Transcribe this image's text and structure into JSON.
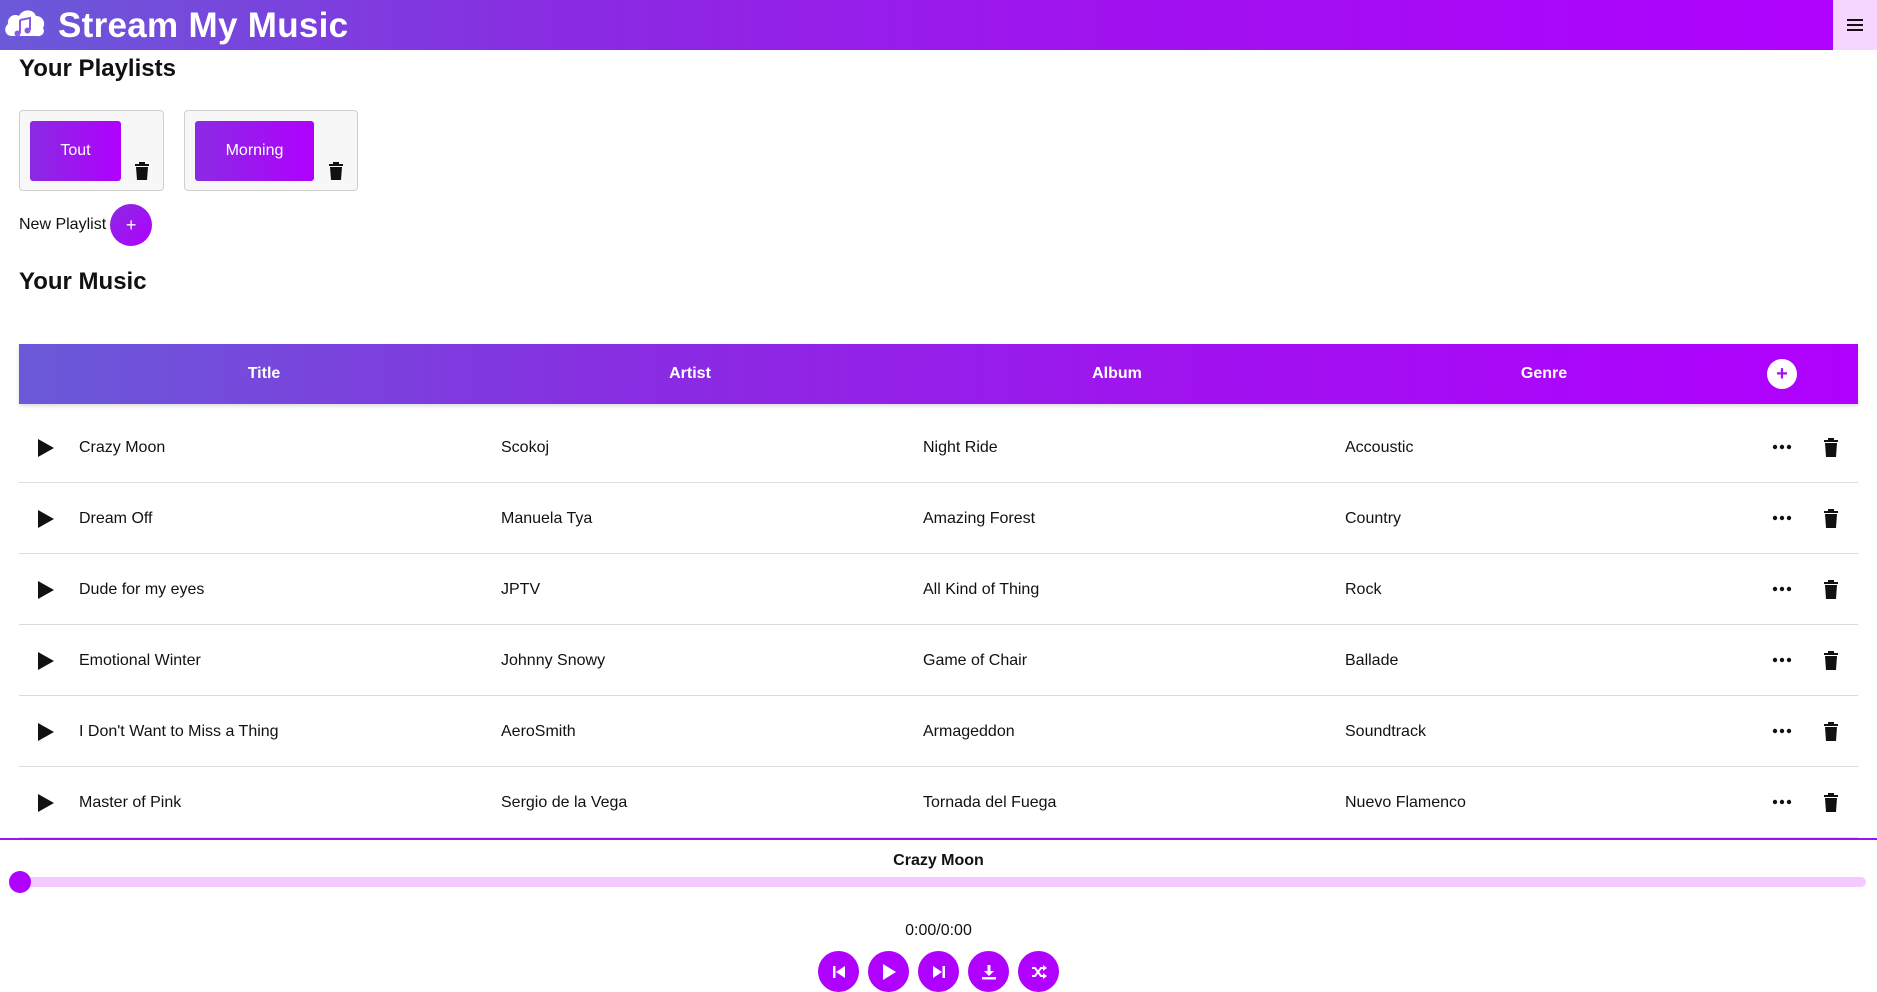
{
  "app": {
    "title": "Stream My Music",
    "accent": "#b000ff",
    "accent_light": "#f3c9ff"
  },
  "icons": {
    "logo": "cloud-music-icon",
    "menu": "hamburger-icon",
    "delete": "trash-icon",
    "more": "ellipsis-icon",
    "play": "play-icon"
  },
  "playlists_section": {
    "heading": "Your Playlists",
    "new_label": "New Playlist",
    "new_button": "+"
  },
  "playlists": [
    {
      "label": "Tout"
    },
    {
      "label": "Morning"
    }
  ],
  "music_section": {
    "heading": "Your Music",
    "add_button": "+"
  },
  "table": {
    "headers": [
      "Title",
      "Artist",
      "Album",
      "Genre"
    ],
    "rows": [
      {
        "title": "Crazy Moon",
        "artist": "Scokoj",
        "album": "Night Ride",
        "genre": "Accoustic"
      },
      {
        "title": "Dream Off",
        "artist": "Manuela Tya",
        "album": "Amazing Forest",
        "genre": "Country"
      },
      {
        "title": "Dude for my eyes",
        "artist": "JPTV",
        "album": "All Kind of Thing",
        "genre": "Rock"
      },
      {
        "title": "Emotional Winter",
        "artist": "Johnny Snowy",
        "album": "Game of Chair",
        "genre": "Ballade"
      },
      {
        "title": "I Don't Want to Miss a Thing",
        "artist": "AeroSmith",
        "album": "Armageddon",
        "genre": "Soundtrack"
      },
      {
        "title": "Master of Pink",
        "artist": "Sergio de la Vega",
        "album": "Tornada del Fuega",
        "genre": "Nuevo Flamenco"
      }
    ]
  },
  "player": {
    "now_playing": "Crazy Moon",
    "time": "0:00/0:00",
    "progress": 0,
    "controls": [
      "skip-back-icon",
      "play-icon",
      "skip-forward-icon",
      "download-icon",
      "shuffle-icon"
    ]
  }
}
